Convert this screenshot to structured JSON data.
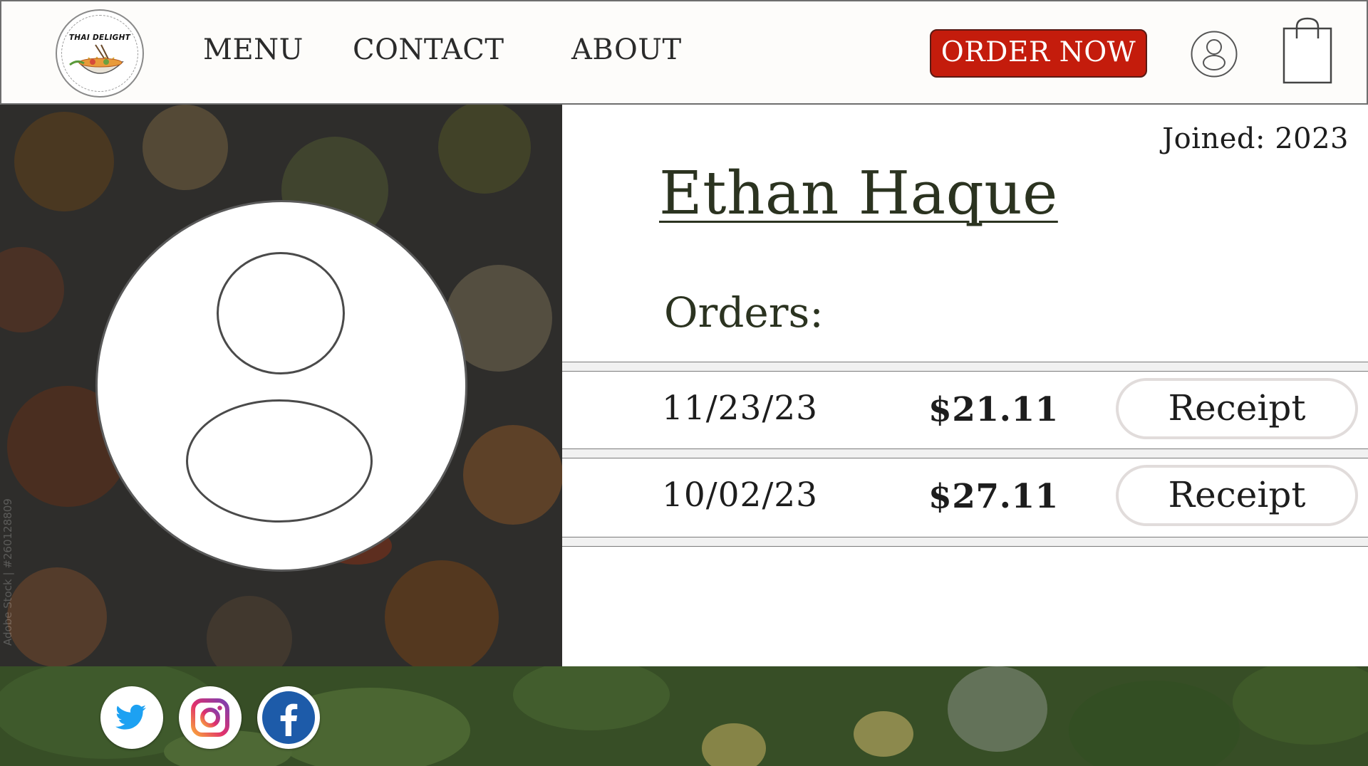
{
  "brand": {
    "logo_text": "THAI DELIGHT"
  },
  "nav": {
    "links": [
      {
        "label": "MENU"
      },
      {
        "label": "CONTACT"
      },
      {
        "label": "ABOUT"
      }
    ],
    "order_button": "ORDER NOW",
    "order_button_color": "#c41c0c"
  },
  "hero": {
    "watermark": "Adobe Stock | #260128809"
  },
  "profile": {
    "joined": "Joined: 2023",
    "name": "Ethan Haque",
    "orders_heading": "Orders:",
    "orders": [
      {
        "date": "11/23/23",
        "amount": "$21.11",
        "action": "Receipt"
      },
      {
        "date": "10/02/23",
        "amount": "$27.11",
        "action": "Receipt"
      }
    ]
  },
  "icons": {
    "profile": "user-icon",
    "cart": "shopping-bag-icon",
    "social": [
      "twitter-icon",
      "instagram-icon",
      "facebook-icon"
    ]
  },
  "colors": {
    "accent": "#c41c0c",
    "heading_text": "#2b3320",
    "footer_green": "#3d5a2b",
    "twitter": "#1da1f2",
    "facebook": "#1d5ba9"
  }
}
